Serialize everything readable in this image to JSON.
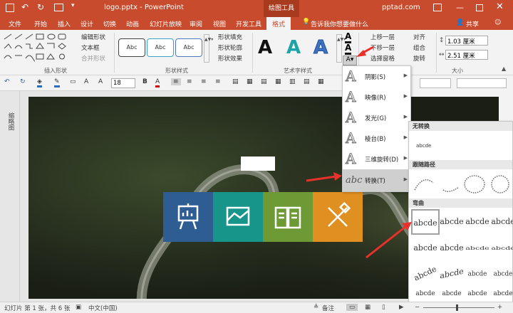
{
  "titlebar": {
    "filename": "logo.pptx - PowerPoint",
    "context": "绘图工具",
    "site": "pptad.com"
  },
  "tabs": [
    "文件",
    "开始",
    "插入",
    "设计",
    "切换",
    "动画",
    "幻灯片放映",
    "审阅",
    "视图",
    "开发工具",
    "格式"
  ],
  "active_tab": "格式",
  "tellme": "告诉我你想要做什么",
  "share": "共享",
  "ribbon": {
    "insert_shapes_label": "插入形状",
    "edit_shape": "编辑形状",
    "textbox": "文本框",
    "merge_shapes": "合并形状",
    "shape_styles_label": "形状样式",
    "swatch_text": "Abc",
    "shape_fill": "形状填充",
    "shape_outline": "形状轮廓",
    "shape_effects": "形状效果",
    "wordart_label": "艺术字样式",
    "bring_forward": "上移一层",
    "send_backward": "下移一层",
    "selection_pane": "选择窗格",
    "align": "对齐",
    "group": "组合",
    "rotate": "旋转",
    "height": "1.03 厘米",
    "width": "2.51 厘米",
    "size_label": "大小"
  },
  "toolbar2": {
    "font_size": "18"
  },
  "left_pane": "缩略图",
  "effects_menu": [
    {
      "label": "阴影(S)"
    },
    {
      "label": "映像(R)"
    },
    {
      "label": "发光(G)"
    },
    {
      "label": "棱台(B)"
    },
    {
      "label": "三维旋转(D)"
    },
    {
      "label": "转换(T)"
    }
  ],
  "transform_menu": {
    "no_transform_header": "无转换",
    "no_transform_sample": "abcde",
    "follow_path_header": "跟随路径",
    "warp_header": "弯曲",
    "warp_sample": "abcde"
  },
  "status": {
    "slide_info": "幻灯片 第 1 张，共 6 张",
    "language": "中文(中国)",
    "notes": "备注"
  },
  "colors": {
    "accent": "#c84b2d",
    "tile1": "#2d5d93",
    "tile2": "#18958a",
    "tile3": "#6e9a36",
    "tile4": "#e09020",
    "arrow": "#e8312b"
  },
  "slide_icons": [
    "presentation-board-icon",
    "chart-envelope-icon",
    "book-icon",
    "ruler-pencil-icon"
  ]
}
